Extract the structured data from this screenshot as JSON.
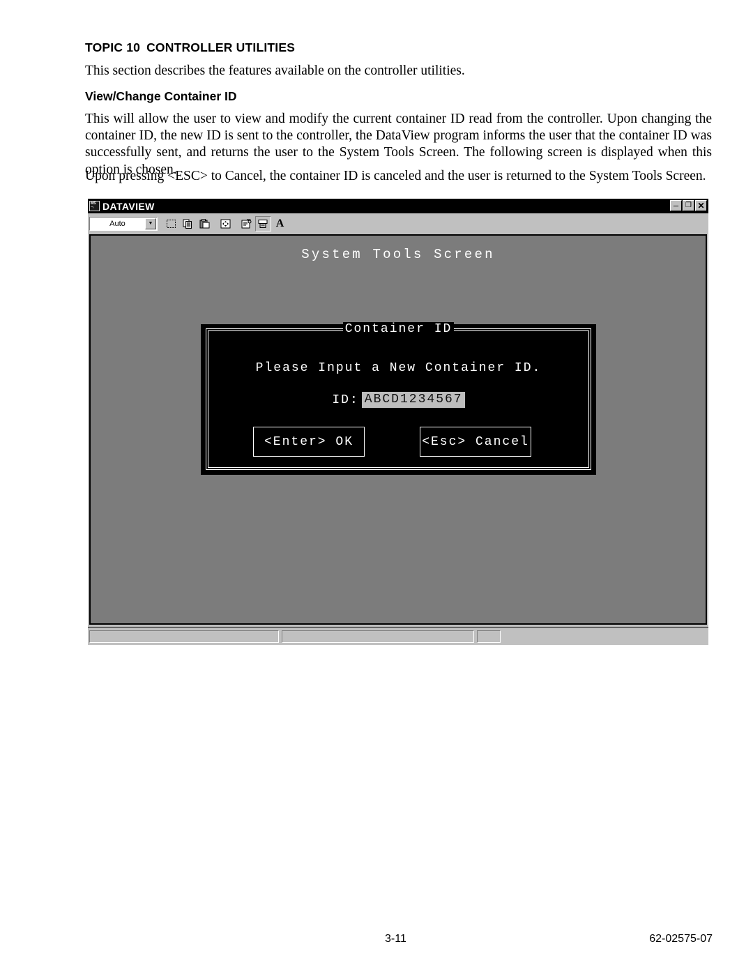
{
  "document": {
    "topic_number": "TOPIC 10",
    "topic_title": "CONTROLLER UTILITIES",
    "intro_paragraph": "This section describes the features available on the controller utilities.",
    "sub_heading": "View/Change Container ID",
    "body_paragraph_1": "This will allow the user to view and modify the current container ID read from the controller. Upon changing the container ID, the new ID is sent to the controller, the DataView program informs the user that the container ID was successfully sent, and returns the user to the System Tools Screen. The following screen is displayed when this option is chosen.",
    "body_paragraph_2": "Upon pressing <ESC> to Cancel, the container ID is canceled and the user is returned to the System Tools Screen."
  },
  "window": {
    "title": "DATAVIEW",
    "icon": "ms-dos-icon",
    "controls": {
      "minimize": "–",
      "restore": "❐",
      "close": "✕"
    },
    "toolbar": {
      "font_size_value": "Auto",
      "font_size_placeholder": "Auto",
      "dropdown_arrow": "▼",
      "buttons": [
        {
          "name": "mark-icon",
          "label": "Mark"
        },
        {
          "name": "copy-icon",
          "label": "Copy"
        },
        {
          "name": "paste-icon",
          "label": "Paste"
        },
        {
          "name": "full-screen-icon",
          "label": "Full Screen"
        },
        {
          "name": "properties-icon",
          "label": "Properties"
        },
        {
          "name": "background-icon",
          "label": "Background"
        },
        {
          "name": "font-icon",
          "label": "A"
        }
      ]
    },
    "statusbar": {
      "pane_1": "",
      "pane_2": "",
      "pane_3": ""
    }
  },
  "dos_screen": {
    "screen_title": "System Tools Screen",
    "dialog": {
      "caption": "Container ID",
      "prompt": "Please Input a New Container ID.",
      "id_label": "ID:",
      "id_value": "ABCD1234567",
      "buttons": {
        "ok": "<Enter> OK",
        "cancel": "<Esc> Cancel"
      }
    }
  },
  "footer": {
    "page_number": "3-11",
    "document_number": "62-02575-07"
  },
  "colors": {
    "window_chrome": "#c0c0c0",
    "titlebar": "#000000",
    "dos_background": "#7c7c7c",
    "dialog_background": "#000000",
    "dialog_text": "#ffffff",
    "input_field": "#bdbdbd"
  }
}
